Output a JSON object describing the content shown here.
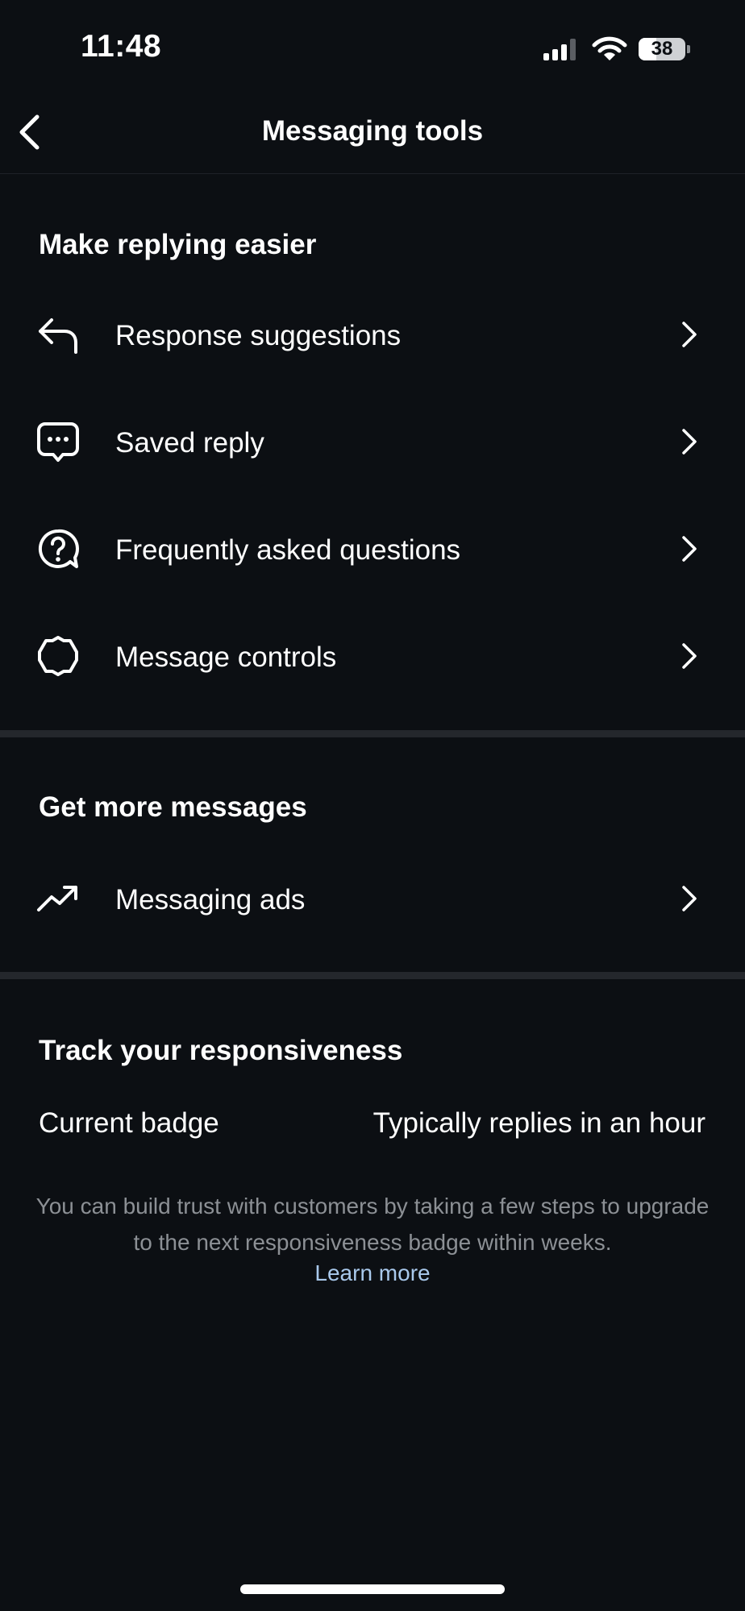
{
  "status_bar": {
    "time": "11:48",
    "signal_icon": "cellular-signal-icon",
    "wifi_icon": "wifi-icon",
    "battery_level": "38",
    "battery_fraction": 0.38
  },
  "header": {
    "back_icon": "chevron-left-icon",
    "title": "Messaging tools"
  },
  "sections": [
    {
      "title": "Make replying easier",
      "items": [
        {
          "label": "Response suggestions",
          "icon": "reply-arrow-icon"
        },
        {
          "label": "Saved reply",
          "icon": "chat-bubble-dots-icon"
        },
        {
          "label": "Frequently asked questions",
          "icon": "question-bubble-icon"
        },
        {
          "label": "Message controls",
          "icon": "settings-badge-icon"
        }
      ]
    },
    {
      "title": "Get more messages",
      "items": [
        {
          "label": "Messaging ads",
          "icon": "trending-up-icon"
        }
      ]
    },
    {
      "title": "Track your responsiveness",
      "badge_label": "Current badge",
      "badge_value": "Typically replies in an hour",
      "info_text": "You can build trust with customers by taking a few steps to upgrade to the next responsiveness badge within weeks.",
      "learn_more": "Learn more"
    }
  ],
  "colors": {
    "background": "#0c0f13",
    "text": "#ffffff",
    "muted_text": "#8c9095",
    "link": "#a9c9ec",
    "separator": "#24272c"
  }
}
